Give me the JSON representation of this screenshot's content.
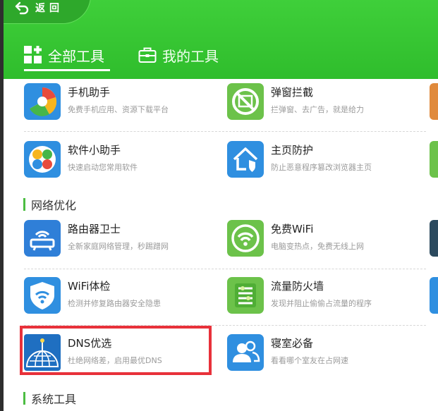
{
  "header": {
    "back_label": "返回",
    "tabs": [
      {
        "label": "全部工具",
        "active": true
      },
      {
        "label": "我的工具",
        "active": false
      }
    ],
    "colors": {
      "header_green": "#34c32f",
      "tab_underline": "#ffffff"
    }
  },
  "tools_top": [
    {
      "title": "手机助手",
      "desc": "免费手机应用、资源下载平台",
      "icon": "phone-assistant-icon"
    },
    {
      "title": "弹窗拦截",
      "desc": "拦弹窗、去广告，就是给力",
      "icon": "popup-block-icon"
    },
    {
      "title": "软件小助手",
      "desc": "快速启动您常用软件",
      "icon": "software-helper-icon"
    },
    {
      "title": "主页防护",
      "desc": "防止恶意程序篡改浏览器主页",
      "icon": "homepage-guard-icon"
    }
  ],
  "sections": [
    {
      "name": "网络优化",
      "items": [
        {
          "title": "路由器卫士",
          "desc": "全新家庭网络管理，秒踢蹭网",
          "icon": "router-guard-icon"
        },
        {
          "title": "免费WiFi",
          "desc": "电脑变热点，免费无线上网",
          "icon": "free-wifi-icon"
        },
        {
          "title": "WiFi体检",
          "desc": "检测并修复路由器安全隐患",
          "icon": "wifi-check-icon"
        },
        {
          "title": "流量防火墙",
          "desc": "发现并阻止偷偷占流量的程序",
          "icon": "traffic-firewall-icon"
        },
        {
          "title": "DNS优选",
          "desc": "杜绝网络差，启用最优DNS",
          "icon": "dns-select-icon",
          "highlighted": true
        },
        {
          "title": "寝室必备",
          "desc": "看看哪个室友在占网速",
          "icon": "dorm-essential-icon"
        }
      ]
    },
    {
      "name": "系统工具",
      "items": []
    }
  ],
  "colors": {
    "highlight_border": "#e8313a",
    "section_bar": "#4cbd42"
  }
}
